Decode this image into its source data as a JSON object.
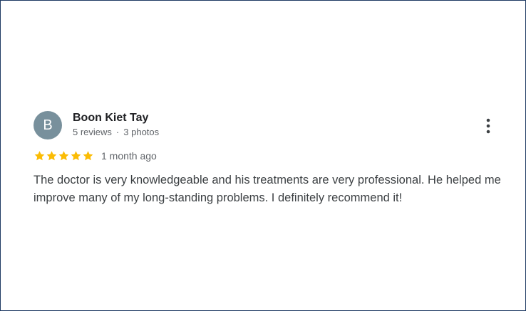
{
  "review": {
    "avatar_initial": "B",
    "avatar_color": "#78909c",
    "author_name": "Boon Kiet Tay",
    "reviews_count": "5 reviews",
    "separator": "·",
    "photos_count": "3 photos",
    "rating": 5,
    "rating_max": 5,
    "star_color": "#fbbc04",
    "time_ago": "1 month ago",
    "text": "The doctor is very knowledgeable and his treatments are very professional. He helped me improve many of my long-standing problems. I definitely recommend it!",
    "menu_icon": "more-vert-icon"
  }
}
